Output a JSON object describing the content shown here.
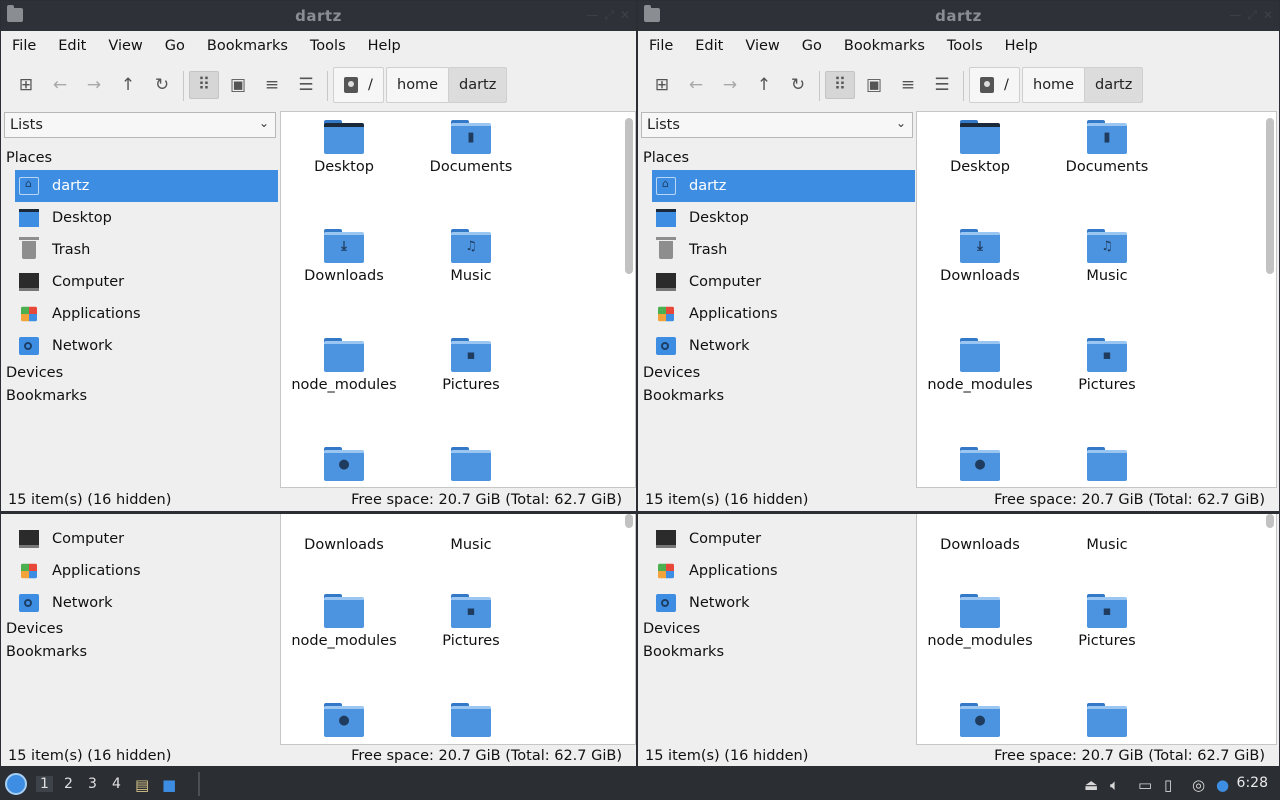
{
  "window": {
    "title": "dartz",
    "menus": [
      "File",
      "Edit",
      "View",
      "Go",
      "Bookmarks",
      "Tools",
      "Help"
    ],
    "breadcrumb": [
      "/",
      "home",
      "dartz"
    ]
  },
  "sidebar": {
    "selector": "Lists",
    "places_heading": "Places",
    "places": [
      {
        "label": "dartz",
        "icon": "home-folder-icon",
        "selected": true
      },
      {
        "label": "Desktop",
        "icon": "desktop-icon"
      },
      {
        "label": "Trash",
        "icon": "trash-icon"
      },
      {
        "label": "Computer",
        "icon": "computer-icon"
      },
      {
        "label": "Applications",
        "icon": "applications-icon"
      },
      {
        "label": "Network",
        "icon": "network-icon"
      }
    ],
    "devices_heading": "Devices",
    "bookmarks_heading": "Bookmarks"
  },
  "files": [
    {
      "name": "Desktop",
      "icon": "desktop-folder-icon"
    },
    {
      "name": "Documents",
      "icon": "documents-folder-icon"
    },
    {
      "name": "Downloads",
      "icon": "downloads-folder-icon"
    },
    {
      "name": "Music",
      "icon": "music-folder-icon"
    },
    {
      "name": "node_modules",
      "icon": "folder-icon"
    },
    {
      "name": "Pictures",
      "icon": "pictures-folder-icon"
    },
    {
      "name": "",
      "icon": "public-folder-icon"
    },
    {
      "name": "",
      "icon": "folder-icon"
    }
  ],
  "status": {
    "items": "15 item(s) (16 hidden)",
    "space": "Free space: 20.7 GiB (Total: 62.7 GiB)"
  },
  "taskbar": {
    "workspaces": [
      "1",
      "2",
      "3",
      "4"
    ],
    "clock": "6:28"
  },
  "colors": {
    "accent": "#3d8ee3",
    "folder": "#4c93e0",
    "titlebar": "#2e3238"
  }
}
